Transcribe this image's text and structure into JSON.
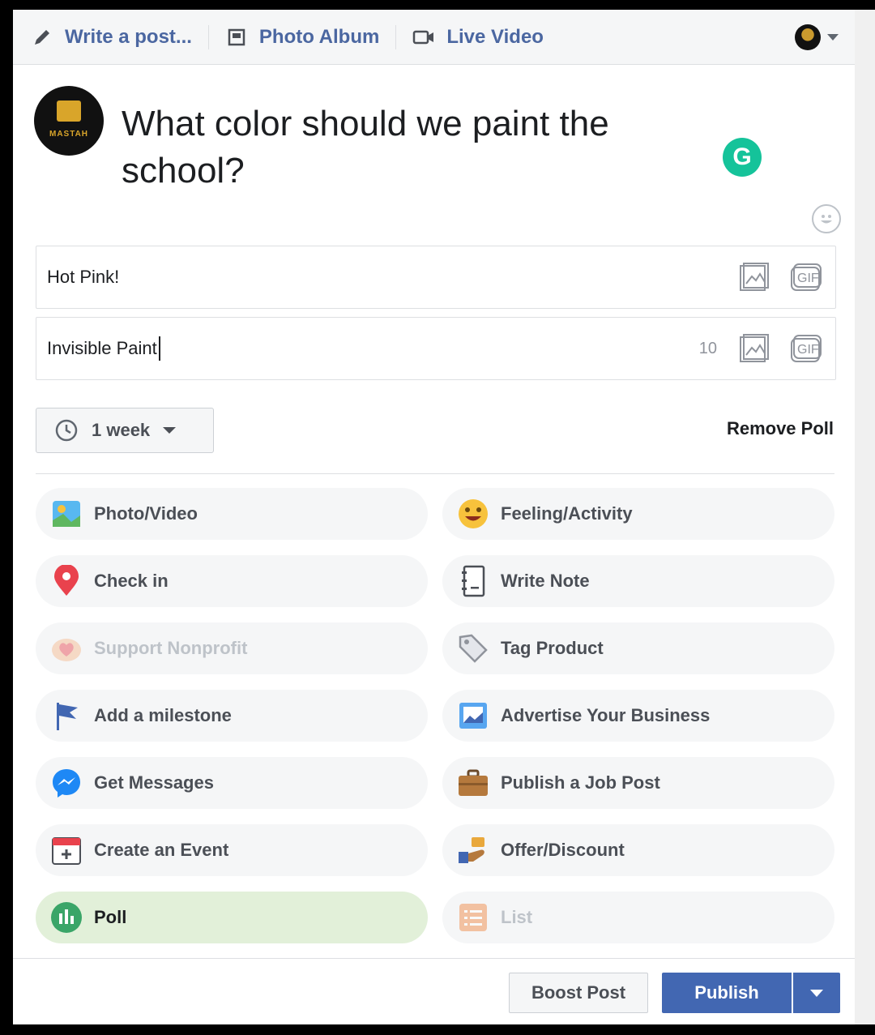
{
  "header": {
    "tabs": [
      {
        "label": "Write a post...",
        "icon": "pencil-icon"
      },
      {
        "label": "Photo Album",
        "icon": "album-icon"
      },
      {
        "label": "Live Video",
        "icon": "video-camera-icon"
      }
    ]
  },
  "composer": {
    "avatar_text": "MASTAH",
    "question": "What color should we paint the school?"
  },
  "poll": {
    "options": [
      {
        "value": "Hot Pink!",
        "count": ""
      },
      {
        "value": "Invisible Paint",
        "count": "10"
      }
    ],
    "duration": "1 week",
    "remove_label": "Remove Poll"
  },
  "actions": [
    {
      "label": "Photo/Video",
      "icon": "photo-video-icon",
      "state": "normal"
    },
    {
      "label": "Feeling/Activity",
      "icon": "smiley-icon",
      "state": "normal"
    },
    {
      "label": "Check in",
      "icon": "location-pin-icon",
      "state": "normal"
    },
    {
      "label": "Write Note",
      "icon": "notebook-icon",
      "state": "normal"
    },
    {
      "label": "Support Nonprofit",
      "icon": "heart-hands-icon",
      "state": "disabled"
    },
    {
      "label": "Tag Product",
      "icon": "tag-icon",
      "state": "normal"
    },
    {
      "label": "Add a milestone",
      "icon": "flag-icon",
      "state": "normal"
    },
    {
      "label": "Advertise Your Business",
      "icon": "advertise-icon",
      "state": "normal"
    },
    {
      "label": "Get Messages",
      "icon": "messenger-icon",
      "state": "normal"
    },
    {
      "label": "Publish a Job Post",
      "icon": "briefcase-icon",
      "state": "normal"
    },
    {
      "label": "Create an Event",
      "icon": "calendar-icon",
      "state": "normal"
    },
    {
      "label": "Offer/Discount",
      "icon": "offer-icon",
      "state": "normal"
    },
    {
      "label": "Poll",
      "icon": "poll-icon",
      "state": "active"
    },
    {
      "label": "List",
      "icon": "list-icon",
      "state": "disabled"
    }
  ],
  "footer": {
    "boost_label": "Boost Post",
    "publish_label": "Publish"
  },
  "colors": {
    "brand_blue": "#4267b2",
    "link_blue": "#4b67a1",
    "poll_active_bg": "#e2f0d9",
    "grammarly_green": "#15c39a"
  }
}
